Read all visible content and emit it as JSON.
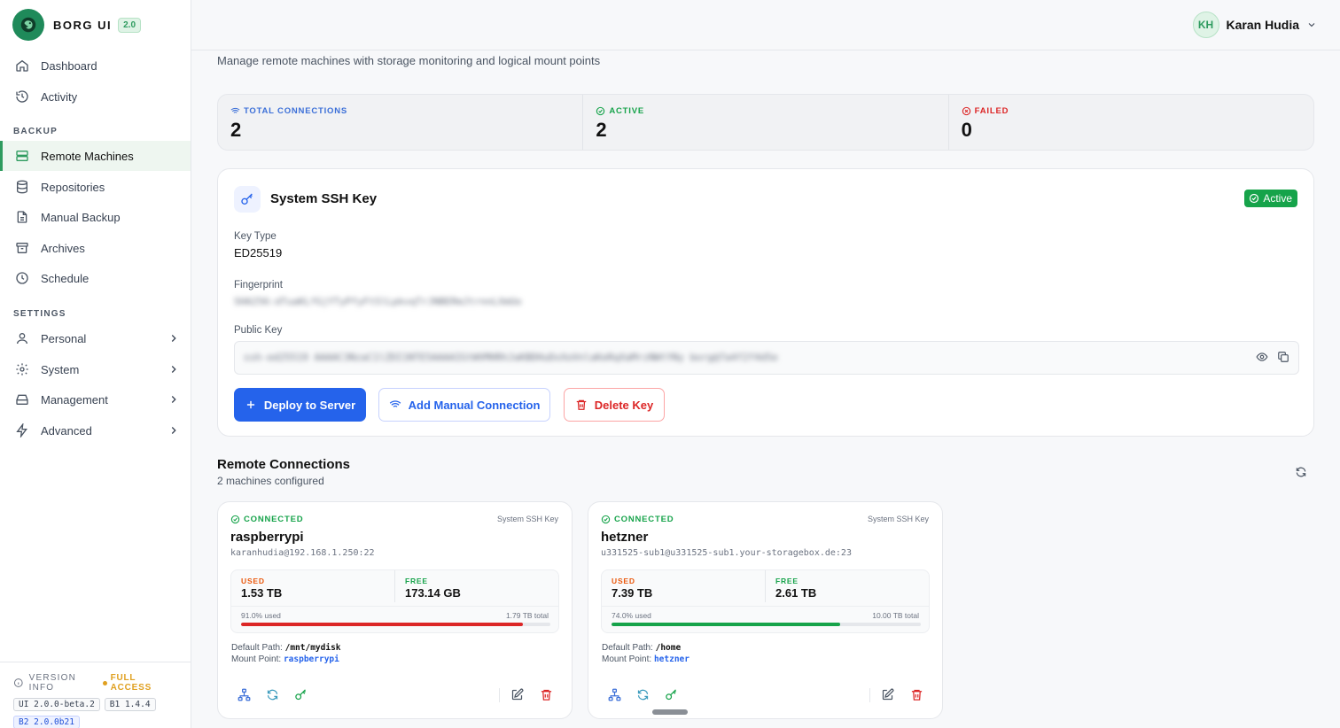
{
  "app": {
    "name": "BORG UI",
    "version_badge": "2.0"
  },
  "sidebar": {
    "top_items": [
      {
        "label": "Dashboard",
        "icon": "home-icon"
      },
      {
        "label": "Activity",
        "icon": "history-icon"
      }
    ],
    "backup_section": "BACKUP",
    "backup_items": [
      {
        "label": "Remote Machines",
        "icon": "server-icon",
        "active": true
      },
      {
        "label": "Repositories",
        "icon": "database-icon"
      },
      {
        "label": "Manual Backup",
        "icon": "file-icon"
      },
      {
        "label": "Archives",
        "icon": "archive-icon"
      },
      {
        "label": "Schedule",
        "icon": "clock-icon"
      }
    ],
    "settings_section": "SETTINGS",
    "settings_items": [
      {
        "label": "Personal",
        "icon": "user-icon"
      },
      {
        "label": "System",
        "icon": "gear-icon"
      },
      {
        "label": "Management",
        "icon": "hard-drive-icon"
      },
      {
        "label": "Advanced",
        "icon": "bolt-icon"
      }
    ],
    "version_info": {
      "label": "VERSION INFO",
      "access": "FULL ACCESS",
      "chips": [
        "UI 2.0.0-beta.2",
        "B1 1.4.4",
        "B2 2.0.0b21"
      ]
    }
  },
  "header": {
    "user_initials": "KH",
    "user_name": "Karan Hudia"
  },
  "page": {
    "subtitle": "Manage remote machines with storage monitoring and logical mount points"
  },
  "stats": [
    {
      "label": "TOTAL CONNECTIONS",
      "value": "2",
      "color": "#3b6fd8"
    },
    {
      "label": "ACTIVE",
      "value": "2",
      "color": "#16a34a"
    },
    {
      "label": "FAILED",
      "value": "0",
      "color": "#dc2626"
    }
  ],
  "ssh_key": {
    "title": "System SSH Key",
    "status": "Active",
    "key_type_label": "Key Type",
    "key_type": "ED25519",
    "fingerprint_label": "Fingerprint",
    "fingerprint": "SHA256:dTuaKLfGjYTyPfyFtSlLpkvqTrJNBERmJtrnnLXmUo",
    "public_key_label": "Public Key",
    "public_key": "ssh-ed25519 AAAAC3NzaC1lZDI1NTE5AAAAIGtWVMHRhJaKBDHuDxXoVnlaKeRqXaMrzNWtYNy borg@7a4f2f4d5e",
    "buttons": {
      "deploy": "Deploy to Server",
      "add_manual": "Add Manual Connection",
      "delete": "Delete Key"
    }
  },
  "remote_connections": {
    "title": "Remote Connections",
    "subtitle": "2 machines configured",
    "machines": [
      {
        "status": "CONNECTED",
        "key_type": "System SSH Key",
        "name": "raspberrypi",
        "host": "karanhudia@192.168.1.250:22",
        "used_label": "USED",
        "used": "1.53 TB",
        "free_label": "FREE",
        "free": "173.14 GB",
        "percent_text": "91.0% used",
        "percent": 91.0,
        "total_text": "1.79 TB total",
        "bar_color": "#dc2626",
        "default_path_label": "Default Path:",
        "default_path": "/mnt/mydisk",
        "mount_point_label": "Mount Point:",
        "mount_point": "raspberrypi"
      },
      {
        "status": "CONNECTED",
        "key_type": "System SSH Key",
        "name": "hetzner",
        "host": "u331525-sub1@u331525-sub1.your-storagebox.de:23",
        "used_label": "USED",
        "used": "7.39 TB",
        "free_label": "FREE",
        "free": "2.61 TB",
        "percent_text": "74.0% used",
        "percent": 74.0,
        "total_text": "10.00 TB total",
        "bar_color": "#16a34a",
        "default_path_label": "Default Path:",
        "default_path": "/home",
        "mount_point_label": "Mount Point:",
        "mount_point": "hetzner"
      }
    ]
  }
}
